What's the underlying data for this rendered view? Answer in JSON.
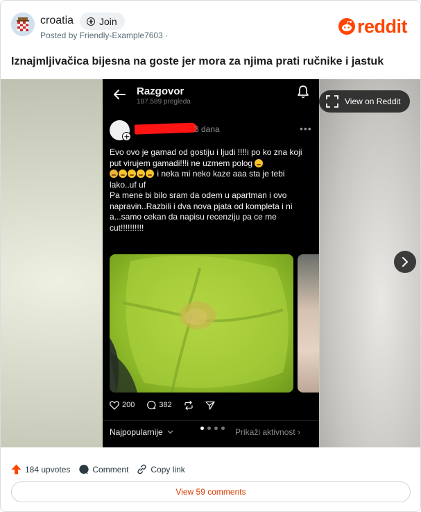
{
  "header": {
    "subreddit": "croatia",
    "join_label": "Join",
    "posted_by": "Posted by Friendly-Example7603 ·",
    "logo_text": "reddit"
  },
  "post": {
    "title": "Iznajmljivačica bijesna na goste jer mora za njima prati ručnike i jastuk"
  },
  "media": {
    "view_on_reddit": "View on Reddit",
    "phone": {
      "screen_title": "Razgovor",
      "views": "187.589 pregleda",
      "time_ago": "3 dana",
      "text_line1": "Evo ovo je gamad od gostiju i ljudi !!!!i po ko zna koji put virujem gamadi!!!i ne uzmem polog",
      "text_line2": "i neka mi neko kaze aaa sta je tebi lako..uf uf",
      "text_line3": "Pa mene bi bilo sram da odem u apartman i ovo napravin..Razbili i dva nova pjata od kompleta i ni a...samo cekan da napisu recenziju pa ce me cut!!!!!!!!!!",
      "likes": "200",
      "comments": "382",
      "sort_label": "Najpopularnije",
      "activity_label": "Prikaži aktivnost"
    }
  },
  "footer": {
    "upvotes": "184 upvotes",
    "comment_label": "Comment",
    "copy_link_label": "Copy link",
    "view_comments": "View 59 comments"
  },
  "colors": {
    "brand": "#ff4500",
    "action_text": "#d93a00",
    "phone_bg": "#000000",
    "pillow_green": "#a6cc36"
  }
}
